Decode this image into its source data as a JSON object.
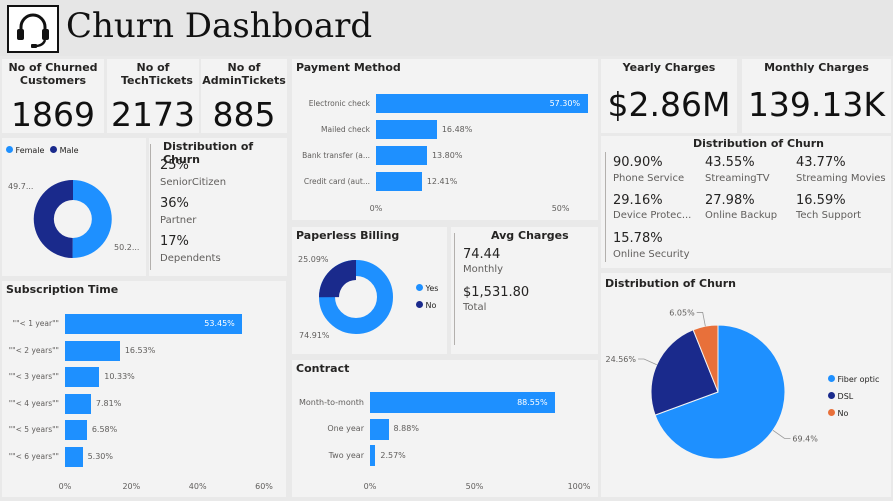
{
  "header": {
    "title": "Churn Dashboard",
    "icon": "headset-icon"
  },
  "kpis": {
    "churned": {
      "label": "No of Churned Customers",
      "value": "1869"
    },
    "tech": {
      "label": "No of TechTickets",
      "value": "2173"
    },
    "admin": {
      "label": "No of AdminTickets",
      "value": "885"
    },
    "yearly": {
      "label": "Yearly Charges",
      "value": "$2.86M"
    },
    "monthly": {
      "label": "Monthly Charges",
      "value": "139.13K"
    }
  },
  "gender": {
    "legend": [
      "Female",
      "Male"
    ],
    "colors": [
      "#1e90ff",
      "#1a2a8c"
    ],
    "left_label": "49.7...",
    "right_label": "50.2...",
    "chart_data": {
      "type": "pie",
      "categories": [
        "Female",
        "Male"
      ],
      "values": [
        50.2,
        49.7
      ]
    }
  },
  "dist_churn_small": {
    "title": "Distribution of Churn",
    "items": [
      {
        "value": "25%",
        "label": "SeniorCitizen"
      },
      {
        "value": "36%",
        "label": "Partner"
      },
      {
        "value": "17%",
        "label": "Dependents"
      }
    ]
  },
  "payment": {
    "title": "Payment Method",
    "chart_data": {
      "type": "bar",
      "categories": [
        "Electronic check",
        "Mailed check",
        "Bank transfer (a...",
        "Credit card (aut..."
      ],
      "values": [
        57.3,
        16.48,
        13.8,
        12.41
      ],
      "value_labels": [
        "57.30%",
        "16.48%",
        "13.80%",
        "12.41%"
      ],
      "xticks": [
        "0%",
        "50%"
      ],
      "xlim": [
        0,
        65
      ]
    }
  },
  "dist_churn_services": {
    "title": "Distribution of Churn",
    "items": [
      {
        "value": "90.90%",
        "label": "Phone Service"
      },
      {
        "value": "43.55%",
        "label": "StreamingTV"
      },
      {
        "value": "43.77%",
        "label": "Streaming Movies"
      },
      {
        "value": "29.16%",
        "label": "Device Protec..."
      },
      {
        "value": "27.98%",
        "label": "Online Backup"
      },
      {
        "value": "16.59%",
        "label": "Tech Support"
      },
      {
        "value": "15.78%",
        "label": "Online Security"
      }
    ]
  },
  "paperless": {
    "title": "Paperless Billing",
    "legend": [
      "Yes",
      "No"
    ],
    "colors": [
      "#1e90ff",
      "#1a2a8c"
    ],
    "top_label": "25.09%",
    "bottom_label": "74.91%",
    "chart_data": {
      "type": "pie",
      "categories": [
        "Yes",
        "No"
      ],
      "values": [
        74.91,
        25.09
      ]
    }
  },
  "avg_charges": {
    "title": "Avg Charges",
    "monthly_value": "74.44",
    "monthly_label": "Monthly",
    "total_value": "$1,531.80",
    "total_label": "Total"
  },
  "subscription": {
    "title": "Subscription Time",
    "chart_data": {
      "type": "bar",
      "categories": [
        "\"\"< 1 year\"\"",
        "\"\"< 2 years\"\"",
        "\"\"< 3 years\"\"",
        "\"\"< 4 years\"\"",
        "\"\"< 5 years\"\"",
        "\"\"< 6 years\"\""
      ],
      "values": [
        53.45,
        16.53,
        10.33,
        7.81,
        6.58,
        5.3
      ],
      "value_labels": [
        "53.45%",
        "16.53%",
        "10.33%",
        "7.81%",
        "6.58%",
        "5.30%"
      ],
      "xticks": [
        "0%",
        "20%",
        "40%",
        "60%"
      ],
      "xlim": [
        0,
        60
      ]
    }
  },
  "contract": {
    "title": "Contract",
    "chart_data": {
      "type": "bar",
      "categories": [
        "Month-to-month",
        "One year",
        "Two year"
      ],
      "values": [
        88.55,
        8.88,
        2.57
      ],
      "value_labels": [
        "88.55%",
        "8.88%",
        "2.57%"
      ],
      "xticks": [
        "0%",
        "50%",
        "100%"
      ],
      "xlim": [
        0,
        100
      ]
    }
  },
  "internet": {
    "title": "Distribution of Churn",
    "legend": [
      "Fiber optic",
      "DSL",
      "No"
    ],
    "colors": [
      "#1e90ff",
      "#1a2a8c",
      "#e8703a"
    ],
    "value_labels": [
      "69.4%",
      "24.56%",
      "6.05%"
    ],
    "chart_data": {
      "type": "pie",
      "categories": [
        "Fiber optic",
        "DSL",
        "No"
      ],
      "values": [
        69.4,
        24.56,
        6.05
      ]
    }
  }
}
